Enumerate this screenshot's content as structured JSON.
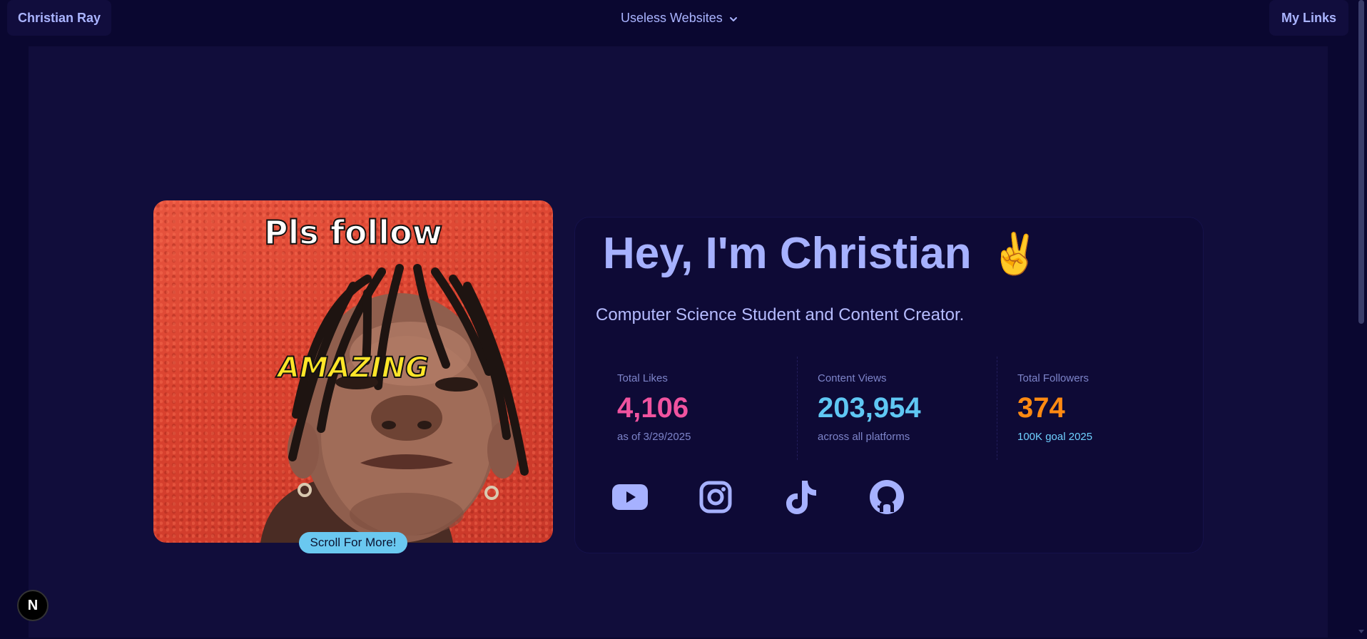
{
  "navbar": {
    "brand": "Christian Ray",
    "menu_label": "Useless Websites",
    "menu_icon": "chevron-down-icon",
    "links_label": "My Links"
  },
  "hero": {
    "caption_top": "Pls follow",
    "caption_mid": "AMAZING",
    "scroll_label": "Scroll For More!"
  },
  "intro": {
    "headline": "Hey, I'm Christian",
    "emoji": "✌️",
    "subtitle": "Computer Science Student and Content Creator."
  },
  "stats": [
    {
      "title": "Total Likes",
      "value": "4,106",
      "desc": "as of 3/29/2025",
      "color": "#f0539f",
      "desc_color": "#7d84c9"
    },
    {
      "title": "Content Views",
      "value": "203,954",
      "desc": "across all platforms",
      "color": "#5fc7f3",
      "desc_color": "#7d84c9"
    },
    {
      "title": "Total Followers",
      "value": "374",
      "desc": "100K goal 2025",
      "color": "#ff8a12",
      "desc_color": "#6fd0ff"
    }
  ],
  "socials": [
    "youtube-icon",
    "instagram-icon",
    "tiktok-icon",
    "github-icon"
  ],
  "colors": {
    "background": "#0a0730",
    "panel": "#110d3b",
    "accent": "#a6b1ff",
    "pill": "#6ac8f0"
  },
  "badge": "N"
}
